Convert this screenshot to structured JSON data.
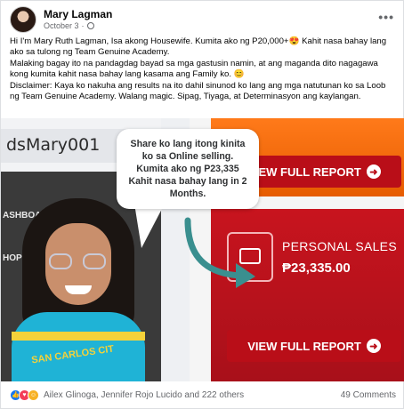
{
  "post": {
    "author": "Mary Lagman",
    "date": "October 3",
    "privacy_icon": "globe-icon",
    "more_icon": "more-options-icon",
    "text": [
      "Hi I'm Mary Ruth Lagman, Isa akong Housewife. Kumita ako ng P20,000+😍 Kahit nasa bahay lang ako sa tulong ng Team Genuine Academy.",
      "Malaking bagay ito na pandagdag bayad sa mga gastusin namin, at ang maganda dito nagagawa kong kumita kahit nasa bahay lang kasama ang Family ko. 😊",
      "Disclaimer: Kaya ko nakuha ang results na ito dahil sinunod ko lang ang mga natutunan ko sa Loob ng Team Genuine Academy. Walang magic. Sipag, Tiyaga, at Determinasyon ang kaylangan."
    ]
  },
  "image": {
    "username": "dsMary001",
    "menu_items": [
      "ASHBOA",
      "HOP N"
    ],
    "bubble_text": "Share ko lang itong kinita ko sa Online selling. Kumita ako ng P23,335 Kahit nasa bahay lang in 2 Months.",
    "report_button_label": "VIEW FULL REPORT",
    "personal_sales_label": "PERSONAL SALES",
    "personal_sales_value": "₱23,335.00",
    "shirt_text": "SAN CARLOS CIT",
    "colors": {
      "orange": "#ff7a1a",
      "red": "#c8141e",
      "teal_arrow": "#3a8f8f"
    }
  },
  "footer": {
    "reactions": [
      "like",
      "love",
      "care"
    ],
    "reacted_by": "Ailex Glinoga, Jennifer Rojo Lucido and 222 others",
    "comments": "49 Comments"
  }
}
